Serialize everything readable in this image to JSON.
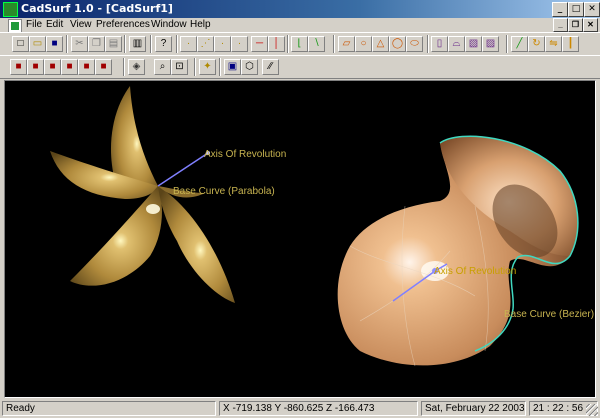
{
  "window": {
    "title": "CadSurf 1.0 - [CadSurf1]",
    "controls": {
      "minimize": "_",
      "maximize": "□",
      "close": "✕"
    }
  },
  "menu": {
    "items": [
      "File",
      "Edit",
      "View",
      "Preferences",
      "Window",
      "Help"
    ],
    "doc_controls": {
      "minimize": "_",
      "restore": "❐",
      "close": "✕"
    }
  },
  "toolbar1": [
    {
      "name": "new-icon",
      "glyph": "□",
      "color": "#000000"
    },
    {
      "name": "open-icon",
      "glyph": "▭",
      "color": "#b08a00"
    },
    {
      "name": "save-icon",
      "glyph": "■",
      "color": "#000080"
    },
    {
      "name": "cut-icon",
      "glyph": "✂",
      "color": "#7a7a7a"
    },
    {
      "name": "copy-icon",
      "glyph": "❐",
      "color": "#7a7a7a"
    },
    {
      "name": "paste-icon",
      "glyph": "▤",
      "color": "#7a7a7a"
    },
    {
      "name": "print-icon",
      "glyph": "▥",
      "color": "#000000"
    },
    {
      "name": "help-icon",
      "glyph": "?",
      "color": "#000000"
    },
    {
      "name": "point-icon",
      "glyph": "·",
      "color": "#b08a00"
    },
    {
      "name": "point-on-curve-icon",
      "glyph": "⋰",
      "color": "#b08a00"
    },
    {
      "name": "point-on-surface-icon",
      "glyph": "·",
      "color": "#b08a00"
    },
    {
      "name": "midpoint-icon",
      "glyph": "·",
      "color": "#b08a00"
    },
    {
      "name": "horizontal-line-icon",
      "glyph": "─",
      "color": "#cc0000"
    },
    {
      "name": "vertical-line-icon",
      "glyph": "│",
      "color": "#cc0000"
    },
    {
      "name": "polyline-icon",
      "glyph": "⌊",
      "color": "#1a9a1a"
    },
    {
      "name": "spline-icon",
      "glyph": "∖",
      "color": "#1a9a1a"
    },
    {
      "name": "parallelogram-icon",
      "glyph": "▱",
      "color": "#cc5500"
    },
    {
      "name": "circle-icon",
      "glyph": "○",
      "color": "#cc5500"
    },
    {
      "name": "triangle-icon",
      "glyph": "△",
      "color": "#cc5500"
    },
    {
      "name": "ellipse-icon",
      "glyph": "◯",
      "color": "#cc5500"
    },
    {
      "name": "slot-icon",
      "glyph": "⬭",
      "color": "#cc5500"
    },
    {
      "name": "surface-extrude-icon",
      "glyph": "▯",
      "color": "#6a2a8a"
    },
    {
      "name": "surface-revolve-icon",
      "glyph": "⌓",
      "color": "#6a2a8a"
    },
    {
      "name": "surface-ruled-icon",
      "glyph": "▧",
      "color": "#6a2a8a"
    },
    {
      "name": "surface-sweep-icon",
      "glyph": "▨",
      "color": "#6a2a8a"
    },
    {
      "name": "trim-icon",
      "glyph": "╱",
      "color": "#1a9a1a"
    },
    {
      "name": "rotate-icon",
      "glyph": "↻",
      "color": "#cc8800"
    },
    {
      "name": "mirror-icon",
      "glyph": "⇋",
      "color": "#cc8800"
    },
    {
      "name": "scale-icon",
      "glyph": "┃",
      "color": "#cc8800"
    }
  ],
  "toolbar2": [
    {
      "name": "view-front-icon",
      "glyph": "■",
      "color": "#a00000"
    },
    {
      "name": "view-back-icon",
      "glyph": "■",
      "color": "#a00000"
    },
    {
      "name": "view-top-icon",
      "glyph": "■",
      "color": "#a00000"
    },
    {
      "name": "view-bottom-icon",
      "glyph": "■",
      "color": "#a00000"
    },
    {
      "name": "view-left-icon",
      "glyph": "■",
      "color": "#a00000"
    },
    {
      "name": "view-right-icon",
      "glyph": "■",
      "color": "#a00000"
    },
    {
      "name": "view-axonometric-icon",
      "glyph": "◈",
      "color": "#333333"
    },
    {
      "name": "zoom-icon",
      "glyph": "⌕",
      "color": "#000000"
    },
    {
      "name": "zoom-window-icon",
      "glyph": "⊡",
      "color": "#000000"
    },
    {
      "name": "pan-icon",
      "glyph": "✦",
      "color": "#b08a00"
    },
    {
      "name": "shaded-mode-icon",
      "glyph": "▣",
      "color": "#000080"
    },
    {
      "name": "wireframe-mode-icon",
      "glyph": "⬡",
      "color": "#000000"
    },
    {
      "name": "hidden-line-icon",
      "glyph": "∕∕",
      "color": "#000000"
    }
  ],
  "viewport": {
    "labels": [
      {
        "text": "Axis Of Revolution",
        "color": "#c8b450"
      },
      {
        "text": "Base Curve (Parabola)",
        "color": "#c8b450"
      },
      {
        "text": "Axis Of Revolution",
        "color": "#c8a000"
      },
      {
        "text": "Base Curve (Bezier)",
        "color": "#c8b450"
      }
    ],
    "colors": {
      "parabola_surface": "#c8a050",
      "bezier_surface": "#e0a878",
      "bezier_curve": "#40d8c0",
      "axis": "#8080ff"
    }
  },
  "status": {
    "text": "Ready",
    "coords": "X -719.138  Y -860.625  Z -166.473",
    "date": "Sat,  February 22 2003,",
    "time": "21 : 22 : 56"
  }
}
